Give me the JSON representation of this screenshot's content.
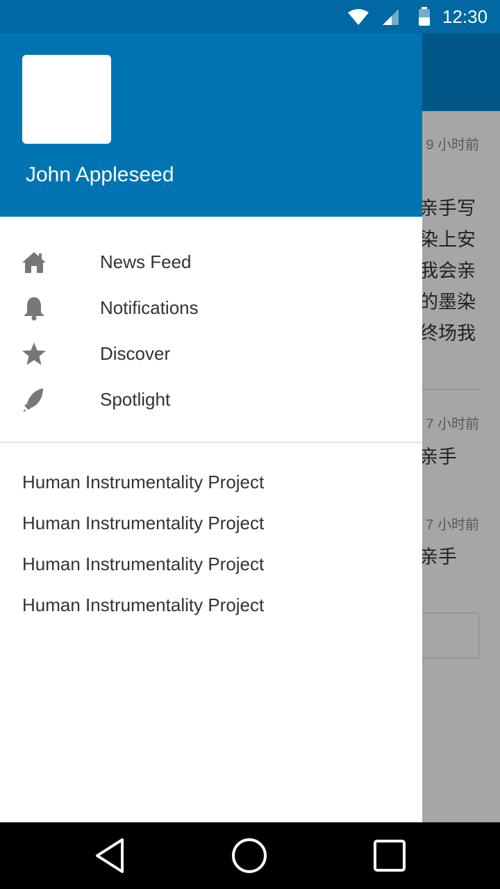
{
  "status_bar": {
    "time": "12:30",
    "icons": [
      "wifi-icon",
      "cell-signal-icon",
      "battery-icon"
    ]
  },
  "background_feed": {
    "items": [
      {
        "time": "9 小时前",
        "lines": [
          "亲手写",
          "染上安",
          "我会亲",
          "的墨染",
          "终场我"
        ]
      },
      {
        "time": "7 小时前",
        "lines": [
          "亲手"
        ]
      },
      {
        "time": "7 小时前",
        "lines": [
          "亲手"
        ]
      }
    ]
  },
  "drawer": {
    "user_name": "John Appleseed",
    "menu": [
      {
        "label": "News Feed",
        "icon": "home-icon"
      },
      {
        "label": "Notifications",
        "icon": "bell-icon"
      },
      {
        "label": "Discover",
        "icon": "star-icon"
      },
      {
        "label": "Spotlight",
        "icon": "rocket-icon"
      }
    ],
    "projects": [
      "Human Instrumentality Project",
      "Human Instrumentality Project",
      "Human Instrumentality Project",
      "Human Instrumentality Project"
    ]
  },
  "colors": {
    "status_bar": "#0068a3",
    "drawer_header": "#0074b3",
    "toolbar": "#0288d1",
    "icon_gray": "#777777"
  }
}
